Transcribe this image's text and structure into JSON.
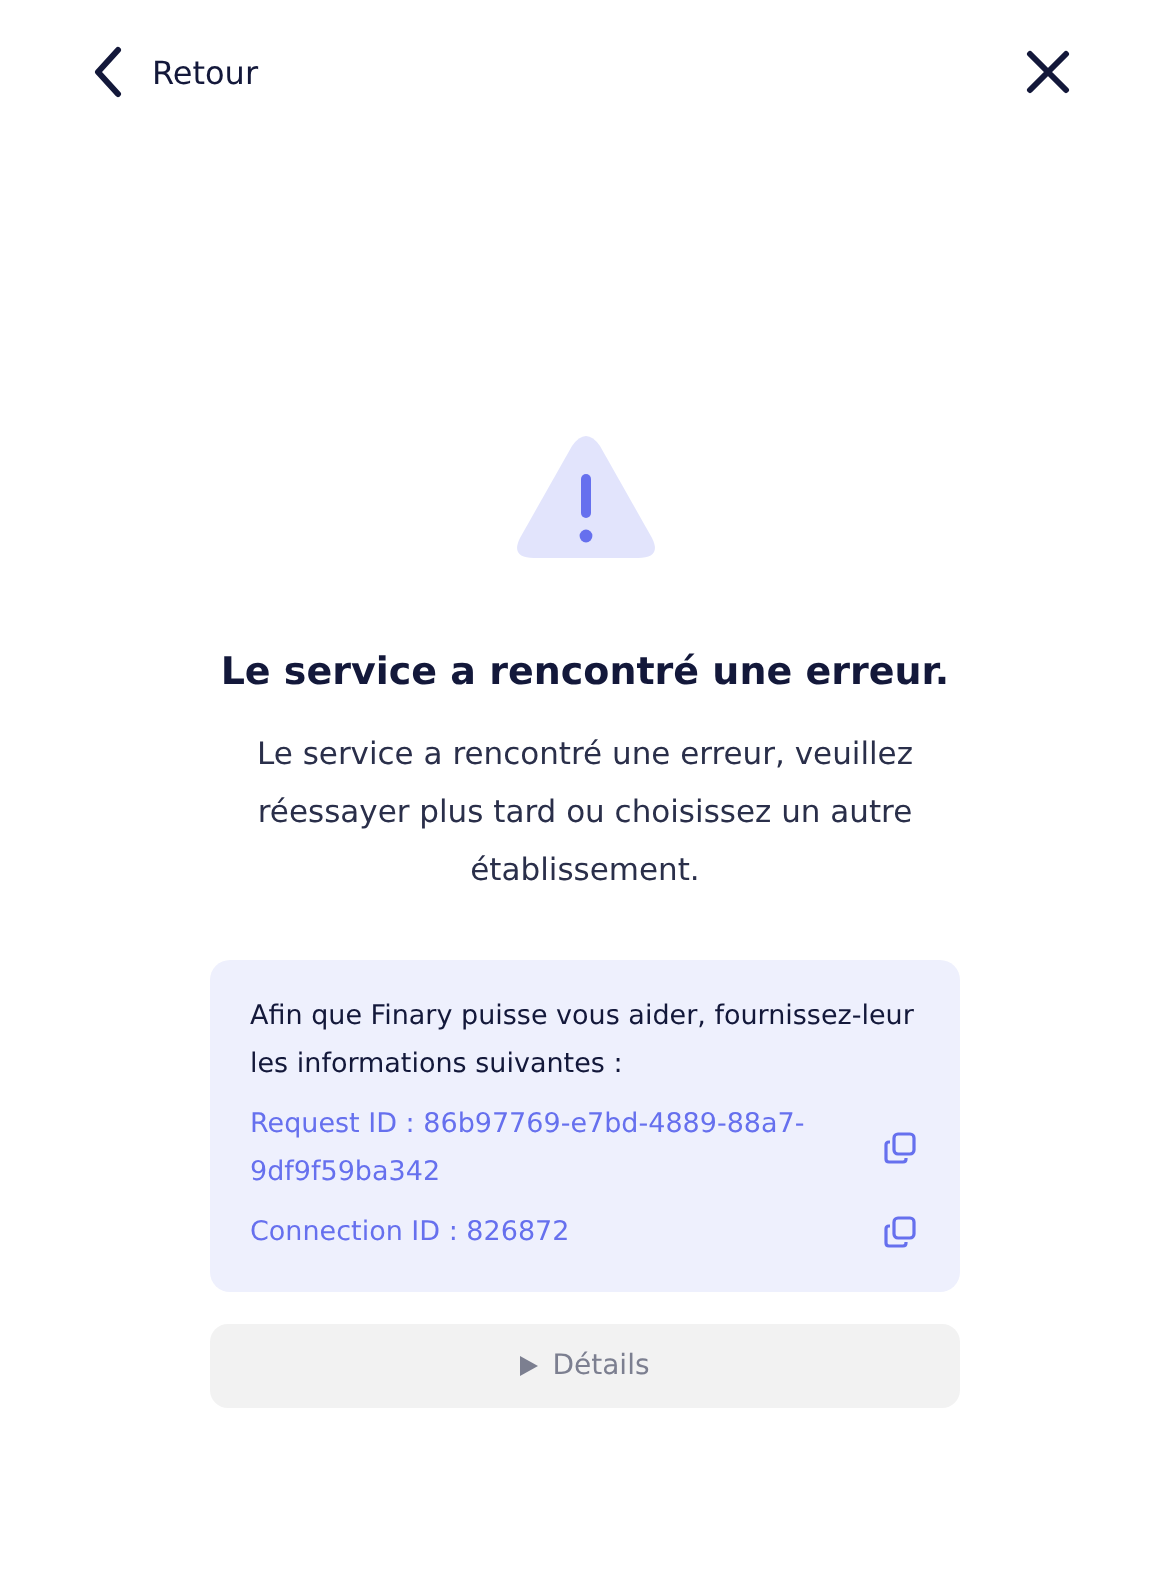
{
  "header": {
    "back_label": "Retour"
  },
  "error": {
    "title": "Le service a rencontré une erreur.",
    "message": "Le service a rencontré une erreur, veuillez réessayer plus tard ou choisissez un autre établissement."
  },
  "info_card": {
    "intro": "Afin que Finary puisse vous aider, fournissez-leur les informations suivantes :",
    "ids": [
      {
        "text": "Request ID : 86b97769-e7bd-4889-88a7-9df9f59ba342"
      },
      {
        "text": "Connection ID : 826872"
      }
    ]
  },
  "details_button": {
    "label": "Détails"
  }
}
